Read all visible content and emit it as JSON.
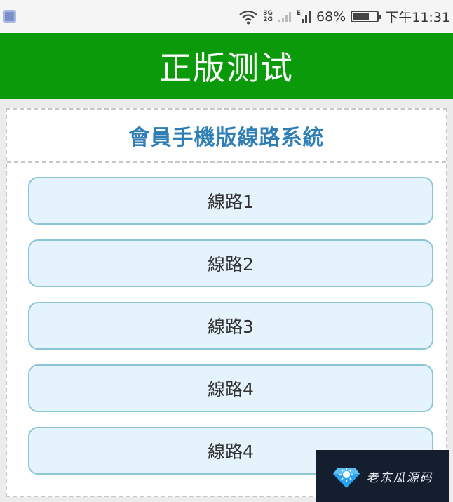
{
  "status_bar": {
    "network_top": "3G",
    "network_bottom": "2G",
    "signal_label": "E",
    "battery_percent": "68%",
    "battery_level": 0.68,
    "time": "下午11:31"
  },
  "header": {
    "title": "正版测试",
    "background_color": "#0a9a0a"
  },
  "panel": {
    "title": "會員手機版線路系統",
    "title_color": "#2f7fb6",
    "lines": [
      {
        "label": "線路1"
      },
      {
        "label": "線路2"
      },
      {
        "label": "線路3"
      },
      {
        "label": "線路4"
      },
      {
        "label": "線路4"
      }
    ]
  },
  "watermark": {
    "text": "老东瓜源码"
  }
}
